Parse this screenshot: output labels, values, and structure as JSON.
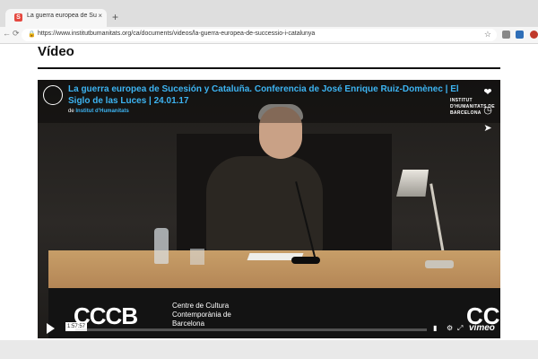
{
  "browser": {
    "tab_title": "La guerra europea de Succesio",
    "tab_close": "×",
    "new_tab": "+",
    "url": "https://www.institutbumanitats.org/ca/documents/videos/la-guerra-europea-de-successio-i-catalunya",
    "nav": {
      "back": "←",
      "forward": "→",
      "reload": "⟳"
    },
    "lock": "🔒",
    "star": "☆"
  },
  "page": {
    "heading": "Vídeo"
  },
  "video": {
    "title": "La guerra europea de Sucesión y Cataluña. Conferencia de José Enrique Ruiz-Domènec | El Siglo de las Luces | 24.01.17",
    "by_prefix": "de",
    "by_author": "Institut d'Humanitats",
    "watermark": "INSTITUT D'HUMANITATS DE BARCELONA",
    "cccb_logo": "CCCB",
    "cccb_sub": "Centre de Cultura Contemporània de Barcelona",
    "cccb_logo_right": "CC",
    "timecode": "1:57:57",
    "brand": "vimeo",
    "progress": 0
  }
}
